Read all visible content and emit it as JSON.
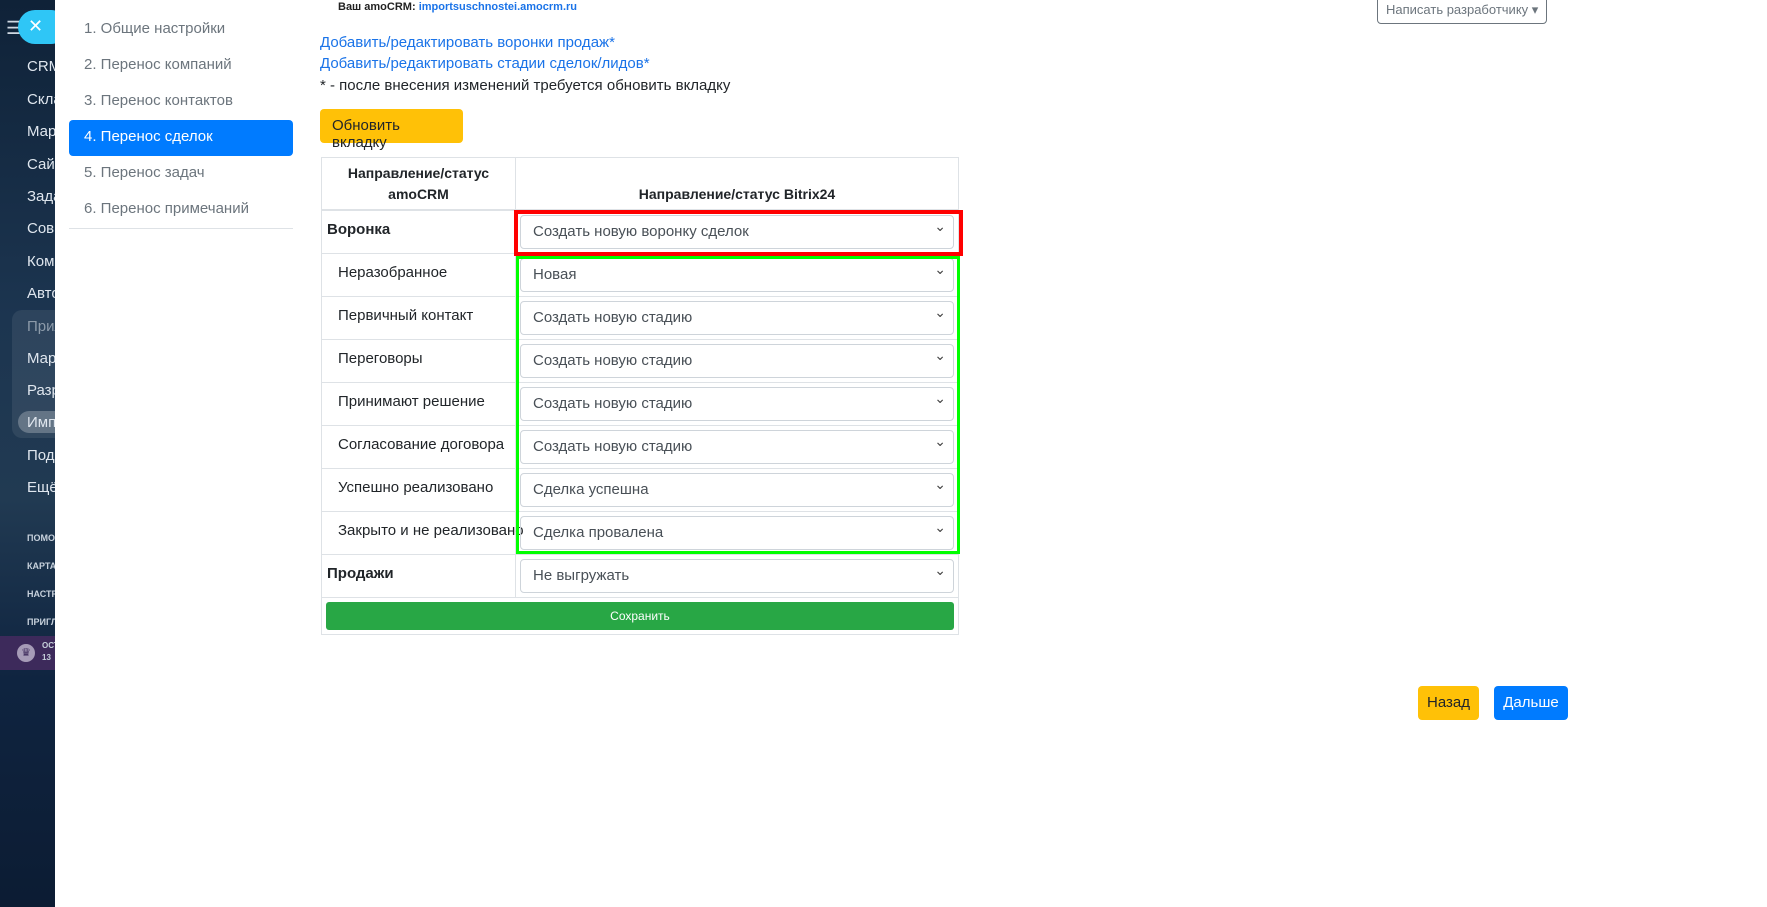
{
  "sidebar": {
    "items": [
      "CRM",
      "Склад",
      "Маркетинг",
      "Сайты",
      "Задачи",
      "Совместная",
      "Компания",
      "Автоматизация",
      "Приложения",
      "Маркет",
      "Разработчикам",
      "Импорт",
      "Подписка",
      "Ещё"
    ],
    "small": [
      "ПОМОЩЬ",
      "КАРТА",
      "НАСТРОЙКИ",
      "ПРИГЛАСИТЬ"
    ],
    "promo": [
      "ОСТ",
      "13"
    ]
  },
  "steps": [
    "1. Общие настройки",
    "2. Перенос компаний",
    "3. Перенос контактов",
    "4. Перенос сделок",
    "5. Перенос задач",
    "6. Перенос примечаний"
  ],
  "top": {
    "label": "Ваш amoCRM:",
    "domain": "importsuschnostei.amocrm.ru",
    "dev_button": "Написать разработчику"
  },
  "links": [
    "Добавить/редактировать воронки продаж*",
    "Добавить/редактировать стадии сделок/лидов*"
  ],
  "note": "* - после внесения изменений требуется обновить вкладку",
  "refresh_button": "Обновить вкладку",
  "table": {
    "head": [
      "Направление/статус amoCRM",
      "Направление/статус Bitrix24"
    ],
    "funnel": {
      "label": "Воронка",
      "value": "Создать новую воронку сделок"
    },
    "stages": [
      {
        "label": "Неразобранное",
        "value": "Новая"
      },
      {
        "label": "Первичный контакт",
        "value": "Создать новую стадию"
      },
      {
        "label": "Переговоры",
        "value": "Создать новую стадию"
      },
      {
        "label": "Принимают решение",
        "value": "Создать новую стадию"
      },
      {
        "label": "Согласование договора",
        "value": "Создать новую стадию"
      },
      {
        "label": "Успешно реализовано",
        "value": "Сделка успешна"
      },
      {
        "label": "Закрыто и не реализовано",
        "value": "Сделка провалена"
      }
    ],
    "sales": {
      "label": "Продажи",
      "value": "Не выгружать"
    },
    "save": "Сохранить"
  },
  "buttons": {
    "back": "Назад",
    "next": "Дальше"
  }
}
